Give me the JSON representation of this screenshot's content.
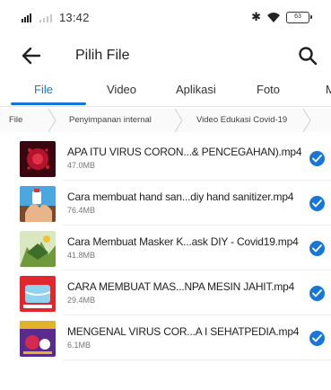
{
  "status_bar": {
    "time": "13:42",
    "battery_text": "63",
    "icons": [
      "signal-icon",
      "bluetooth-icon",
      "wifi-icon",
      "battery-icon"
    ]
  },
  "app_bar": {
    "title": "Pilih File",
    "back_icon": "arrow-left-icon",
    "search_icon": "search-icon"
  },
  "tabs": [
    {
      "label": "File",
      "active": true
    },
    {
      "label": "Video",
      "active": false
    },
    {
      "label": "Aplikasi",
      "active": false
    },
    {
      "label": "Foto",
      "active": false
    },
    {
      "label": "M",
      "active": false
    }
  ],
  "breadcrumb": [
    "File",
    "Penyimpanan internal",
    "Video Edukasi Covid-19"
  ],
  "files": [
    {
      "name": "APA ITU VIRUS CORON...& PENCEGAHAN).mp4",
      "size": "47.0MB",
      "selected": true
    },
    {
      "name": "Cara membuat hand san...diy hand sanitizer.mp4",
      "size": "76.4MB",
      "selected": true
    },
    {
      "name": "Cara Membuat Masker K...ask DIY - Covid19.mp4",
      "size": "41.8MB",
      "selected": true
    },
    {
      "name": "CARA MEMBUAT MAS...NPA MESIN JAHIT.mp4",
      "size": "29.4MB",
      "selected": true
    },
    {
      "name": "MENGENAL VIRUS COR...A I SEHATPEDIA.mp4",
      "size": "6.1MB",
      "selected": true
    }
  ],
  "colors": {
    "accent": "#1877d6"
  }
}
